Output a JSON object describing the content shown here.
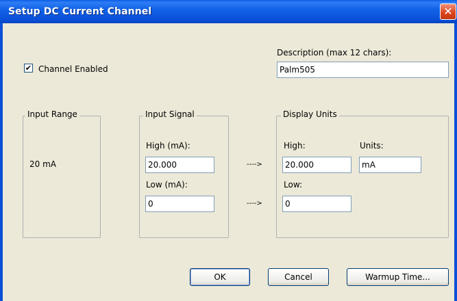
{
  "window": {
    "title": "Setup DC Current Channel",
    "close_glyph": "✕"
  },
  "channel_enabled": {
    "label": "Channel Enabled",
    "checked": true,
    "check_glyph": "✔"
  },
  "description": {
    "label": "Description (max 12 chars):",
    "value": "Palm505"
  },
  "input_range": {
    "legend": "Input Range",
    "value": "20 mA"
  },
  "input_signal": {
    "legend": "Input Signal",
    "high_label": "High (mA):",
    "high_value": "20.000",
    "low_label": "Low (mA):",
    "low_value": "0"
  },
  "arrows": {
    "high": "---->",
    "low": "---->"
  },
  "display_units": {
    "legend": "Display Units",
    "high_label": "High:",
    "high_value": "20.000",
    "units_label": "Units:",
    "units_value": "mA",
    "low_label": "Low:",
    "low_value": "0"
  },
  "buttons": {
    "ok": "OK",
    "cancel": "Cancel",
    "warmup": "Warmup Time..."
  },
  "colors": {
    "titlebar": "#0a5ee6",
    "dialog_bg": "#ece9d8",
    "close": "#d9431a"
  }
}
